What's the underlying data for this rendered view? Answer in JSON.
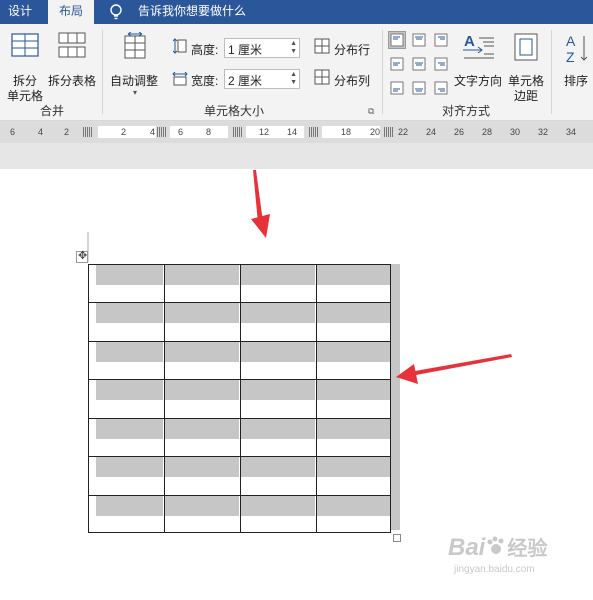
{
  "tabs": {
    "design": "设计",
    "layout": "布局"
  },
  "tell_me": "告诉我你想要做什么",
  "ribbon": {
    "merge_group": {
      "label": "合并",
      "split_cells_line1": "拆分",
      "split_cells_line2": "单元格",
      "split_table": "拆分表格"
    },
    "cell_size_group": {
      "label": "单元格大小",
      "autofit": "自动调整",
      "height_label": "高度:",
      "height_value": "1 厘米",
      "width_label": "宽度:",
      "width_value": "2 厘米",
      "distribute_rows": "分布行",
      "distribute_cols": "分布列"
    },
    "alignment_group": {
      "label": "对齐方式",
      "text_direction": "文字方向",
      "cell_margins_line1": "单元格",
      "cell_margins_line2": "边距"
    },
    "sort": "排序"
  },
  "ruler": {
    "labels": [
      "6",
      "4",
      "2",
      "2",
      "4",
      "6",
      "8",
      "12",
      "14",
      "18",
      "20",
      "22",
      "24",
      "26",
      "28",
      "30",
      "32",
      "34"
    ]
  },
  "table": {
    "rows": 7,
    "cols": 4
  },
  "watermark": {
    "brand": "Bai",
    "brand2": "经验",
    "url": "jingyan.baidu.com"
  },
  "colors": {
    "tab_bar": "#2b579a",
    "ribbon": "#f3f3f3",
    "selection": "#c6c6c6",
    "arrow": "#e8323a"
  }
}
